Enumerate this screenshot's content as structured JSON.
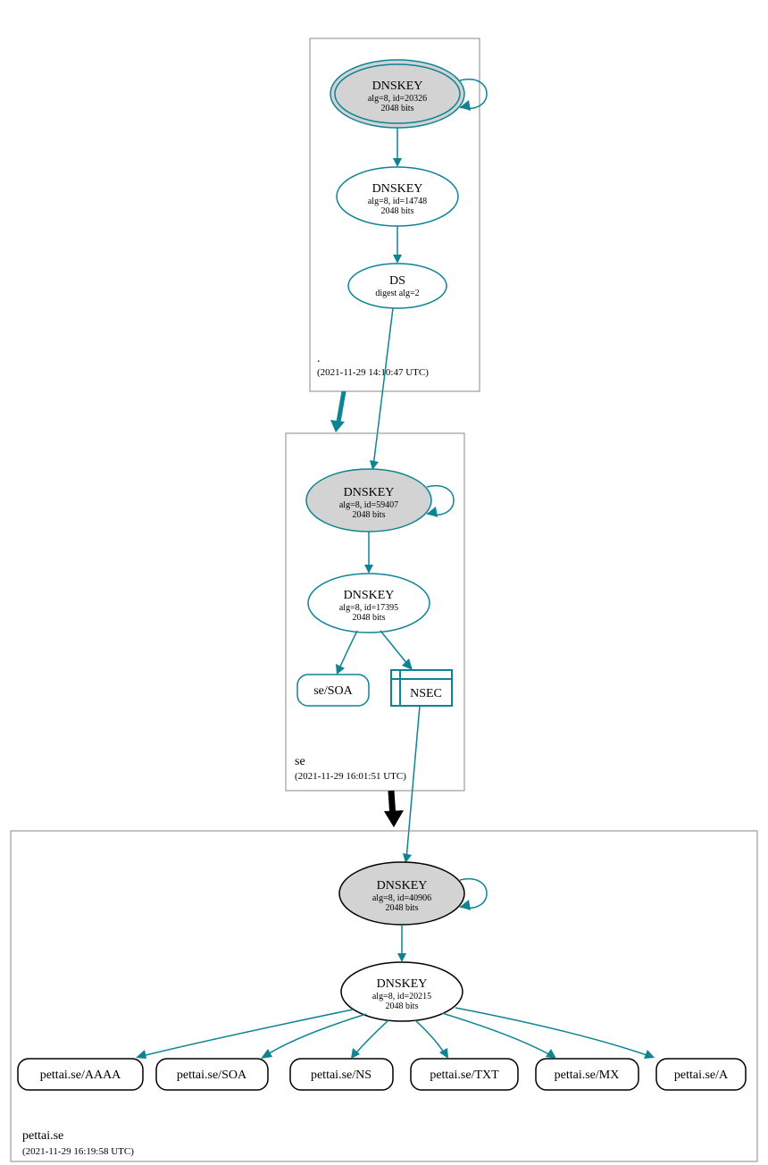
{
  "zones": {
    "root": {
      "label": ".",
      "timestamp": "(2021-11-29 14:10:47 UTC)",
      "ksk": {
        "title": "DNSKEY",
        "alg": "alg=8, id=20326",
        "bits": "2048 bits"
      },
      "zsk": {
        "title": "DNSKEY",
        "alg": "alg=8, id=14748",
        "bits": "2048 bits"
      },
      "ds": {
        "title": "DS",
        "digest": "digest alg=2"
      }
    },
    "se": {
      "label": "se",
      "timestamp": "(2021-11-29 16:01:51 UTC)",
      "ksk": {
        "title": "DNSKEY",
        "alg": "alg=8, id=59407",
        "bits": "2048 bits"
      },
      "zsk": {
        "title": "DNSKEY",
        "alg": "alg=8, id=17395",
        "bits": "2048 bits"
      },
      "soa": {
        "label": "se/SOA"
      },
      "nsec": {
        "label": "NSEC"
      }
    },
    "pettai": {
      "label": "pettai.se",
      "timestamp": "(2021-11-29 16:19:58 UTC)",
      "ksk": {
        "title": "DNSKEY",
        "alg": "alg=8, id=40906",
        "bits": "2048 bits"
      },
      "zsk": {
        "title": "DNSKEY",
        "alg": "alg=8, id=20215",
        "bits": "2048 bits"
      },
      "records": {
        "aaaa": "pettai.se/AAAA",
        "soa": "pettai.se/SOA",
        "ns": "pettai.se/NS",
        "txt": "pettai.se/TXT",
        "mx": "pettai.se/MX",
        "a": "pettai.se/A"
      }
    }
  }
}
